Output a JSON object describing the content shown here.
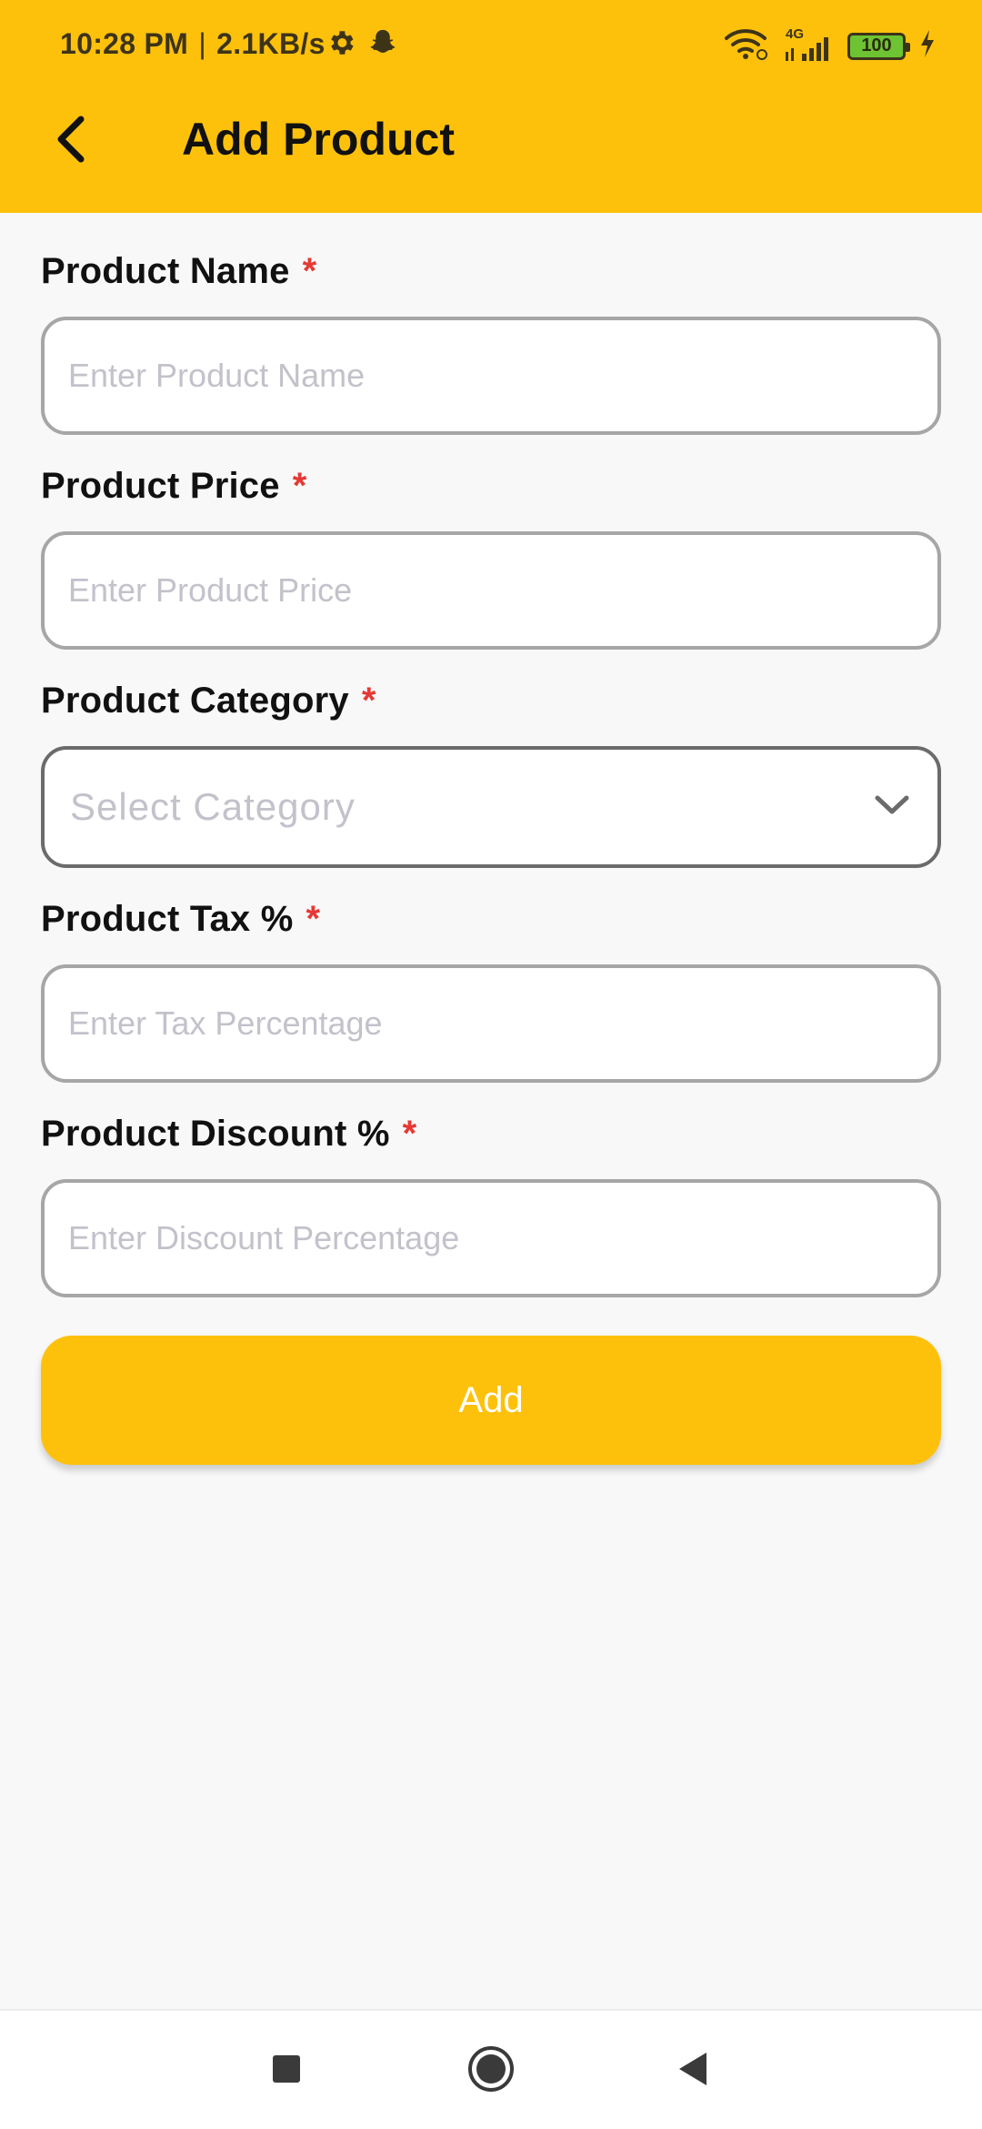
{
  "status_bar": {
    "time": "10:28 PM",
    "separator": "|",
    "speed": "2.1KB/s",
    "network_label": "4G",
    "battery": "100",
    "icons": [
      "settings-icon",
      "snapchat-icon",
      "wifi-icon",
      "signal-icon",
      "battery-icon",
      "charging-icon"
    ]
  },
  "app_bar": {
    "title": "Add Product",
    "back_icon": "chevron-left-icon"
  },
  "form": {
    "required_marker": "*",
    "fields": [
      {
        "label": "Product Name",
        "placeholder": "Enter Product Name",
        "value": ""
      },
      {
        "label": "Product Price",
        "placeholder": "Enter Product Price",
        "value": ""
      },
      {
        "label": "Product Category",
        "selected": "Select Category",
        "icon": "chevron-down-icon"
      },
      {
        "label": "Product Tax %",
        "placeholder": "Enter Tax Percentage",
        "value": ""
      },
      {
        "label": "Product Discount %",
        "placeholder": "Enter Discount Percentage",
        "value": ""
      }
    ],
    "submit_label": "Add"
  },
  "nav_bar": {
    "icons": [
      "recent-apps-icon",
      "home-icon",
      "back-icon"
    ]
  },
  "colors": {
    "accent": "#fec10b",
    "required": "#e53935",
    "placeholder": "#c3c2cb",
    "background": "#f8f8f8"
  }
}
